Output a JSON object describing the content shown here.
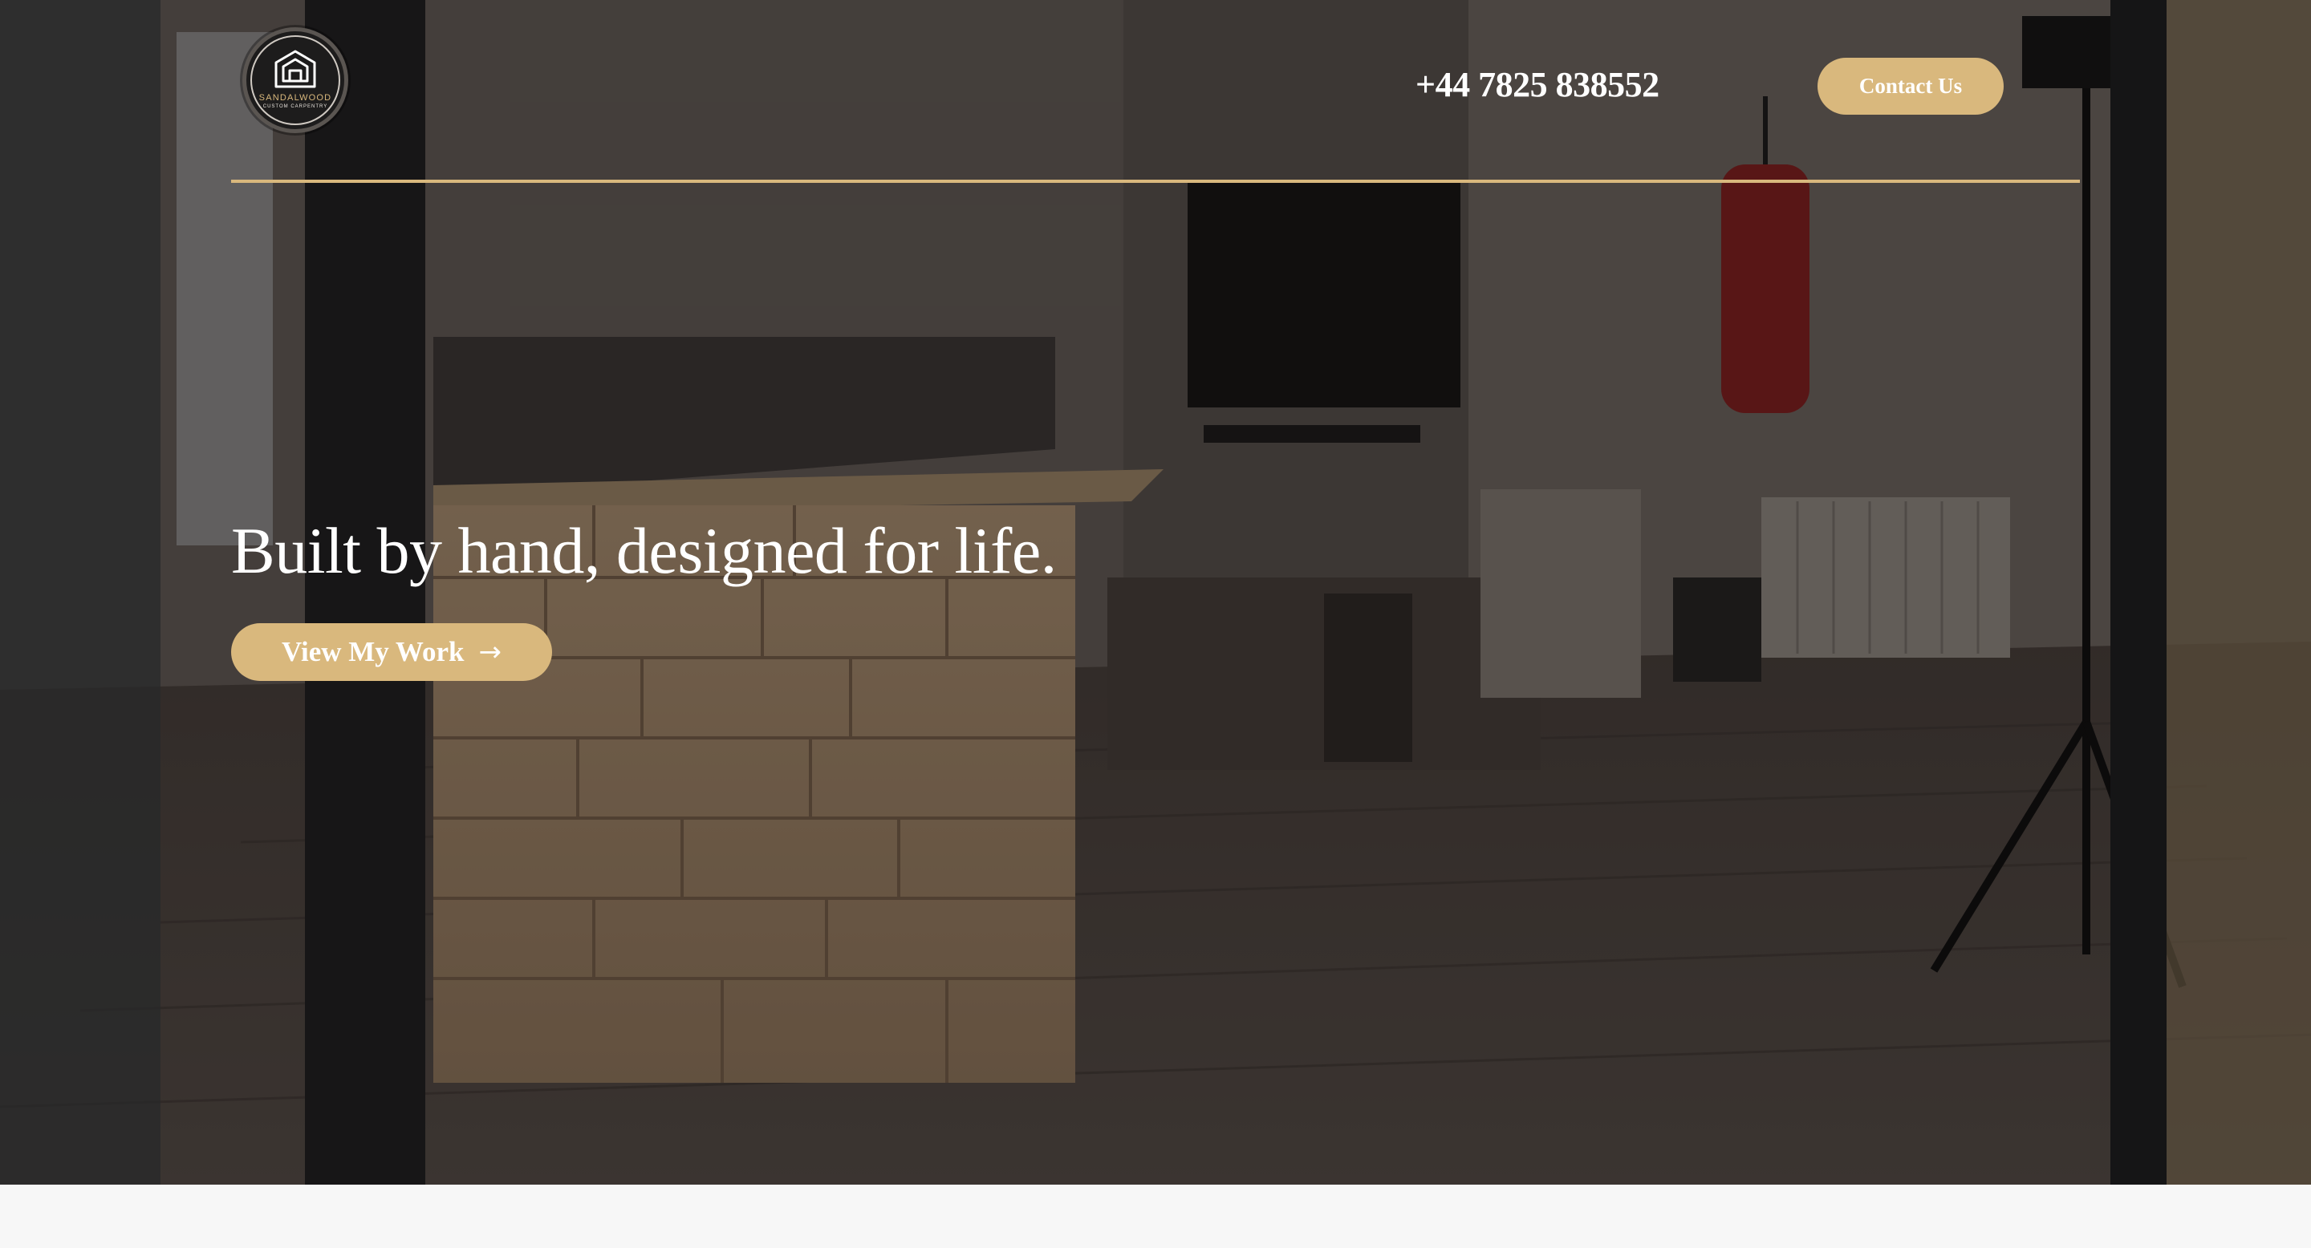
{
  "brand": {
    "logo_name": "SANDALWOOD",
    "logo_tagline": "CUSTOM CARPENTRY",
    "logo_icon": "house-cube-icon"
  },
  "header": {
    "phone": "+44 7825 838552",
    "contact_label": "Contact Us"
  },
  "hero": {
    "headline": "Built by hand, designed for life.",
    "cta_label": "View My Work",
    "cta_icon": "arrow-right-icon",
    "cta_arrow_glyph": "→"
  },
  "colors": {
    "accent": "#d9b87d",
    "text_on_dark": "#ffffff",
    "page_background": "#f7f7f7"
  }
}
